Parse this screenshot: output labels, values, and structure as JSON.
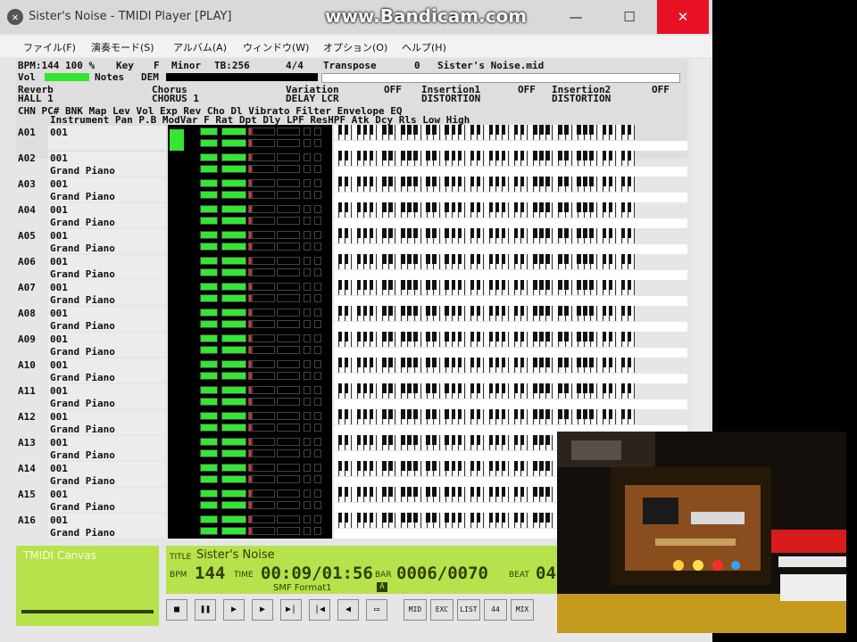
{
  "window": {
    "title": "Sister's Noise - TMIDI Player [PLAY]",
    "app_icon": "tmidi-logo-icon",
    "minimize_icon": "—",
    "maximize_icon": "☐",
    "close_icon": "✕"
  },
  "watermark": "www.Bandicam.com",
  "menu": [
    {
      "label": "ファイル(F)"
    },
    {
      "label": "演奏モード(S)"
    },
    {
      "label": "アルバム(A)"
    },
    {
      "label": "ウィンドウ(W)"
    },
    {
      "label": "オプション(O)"
    },
    {
      "label": "ヘルプ(H)"
    }
  ],
  "info": {
    "tempo_line": "BPM:144 100 %",
    "key_label": "Key",
    "key_value": "F",
    "mode": "Minor",
    "tick": "TB:256",
    "time_sig": "4/4",
    "transpose_label": "Transpose",
    "transpose_value": "0",
    "filename": "Sister's Noise.mid",
    "vol_label": "Vol",
    "notes_label": "Notes",
    "notes_value": "DEM",
    "reverb_label": "Reverb",
    "reverb_value": "HALL 1",
    "chorus_label": "Chorus",
    "chorus_value": "CHORUS 1",
    "variation_label": "Variation",
    "variation_state": "OFF",
    "variation_value": "DELAY LCR",
    "insertion1_label": "Insertion1",
    "insertion1_state": "OFF",
    "insertion1_value": "DISTORTION",
    "insertion2_label": "Insertion2",
    "insertion2_state": "OFF",
    "insertion2_value": "DISTORTION",
    "header1": "CHN PC# BNK Map   Lev Vol Exp Rev Cho Dl   Vibrato      Filter   Envelope EQ",
    "header2": "Instrument         Pan P.B ModVar F   Rat Dpt Dly LPF ResHPF Atk Dcy Rls Low  High"
  },
  "channels": [
    {
      "id": "A01",
      "program": "001",
      "instrument": "",
      "vol": 0.9,
      "keys": 0.35
    },
    {
      "id": "A02",
      "program": "001",
      "instrument": "Grand Piano",
      "vol": 0.0,
      "keys": 0
    },
    {
      "id": "A03",
      "program": "001",
      "instrument": "Grand Piano",
      "vol": 0.0,
      "keys": 0
    },
    {
      "id": "A04",
      "program": "001",
      "instrument": "Grand Piano",
      "vol": 0.0,
      "keys": 0
    },
    {
      "id": "A05",
      "program": "001",
      "instrument": "Grand Piano",
      "vol": 0.0,
      "keys": 0
    },
    {
      "id": "A06",
      "program": "001",
      "instrument": "Grand Piano",
      "vol": 0.0,
      "keys": 0
    },
    {
      "id": "A07",
      "program": "001",
      "instrument": "Grand Piano",
      "vol": 0.0,
      "keys": 0
    },
    {
      "id": "A08",
      "program": "001",
      "instrument": "Grand Piano",
      "vol": 0.0,
      "keys": 0
    },
    {
      "id": "A09",
      "program": "001",
      "instrument": "Grand Piano",
      "vol": 0.0,
      "keys": 0
    },
    {
      "id": "A10",
      "program": "001",
      "instrument": "Grand Piano",
      "vol": 0.0,
      "keys": 0
    },
    {
      "id": "A11",
      "program": "001",
      "instrument": "Grand Piano",
      "vol": 0.0,
      "keys": 0
    },
    {
      "id": "A12",
      "program": "001",
      "instrument": "Grand Piano",
      "vol": 0.0,
      "keys": 0
    },
    {
      "id": "A13",
      "program": "001",
      "instrument": "Grand Piano",
      "vol": 0.0,
      "keys": 0
    },
    {
      "id": "A14",
      "program": "001",
      "instrument": "Grand Piano",
      "vol": 0.0,
      "keys": 0
    },
    {
      "id": "A15",
      "program": "001",
      "instrument": "Grand Piano",
      "vol": 0.0,
      "keys": 0
    },
    {
      "id": "A16",
      "program": "001",
      "instrument": "Grand Piano",
      "vol": 0.0,
      "keys": 0
    }
  ],
  "canvas_panel": {
    "title": "TMIDI Canvas"
  },
  "lcd": {
    "title_label": "TITLE",
    "title": "Sister's Noise",
    "bpm_label": "BPM",
    "bpm": "144",
    "time_label": "TIME",
    "time": "00:09/01:56",
    "bar_label": "BAR",
    "bar": "0006/0070",
    "beat_label": "BEAT",
    "beat": "04",
    "format": "SMF Format1",
    "format_badge": "A"
  },
  "transport": [
    {
      "name": "stop-icon",
      "label": "■"
    },
    {
      "name": "pause-icon",
      "label": "❚❚"
    },
    {
      "name": "play-icon",
      "label": "▶"
    },
    {
      "name": "next-icon",
      "label": "▶"
    },
    {
      "name": "skip-forward-icon",
      "label": "▶|"
    },
    {
      "name": "skip-back-icon",
      "label": "|◀"
    },
    {
      "name": "rewind-icon",
      "label": "◀"
    },
    {
      "name": "window-icon",
      "label": "▭"
    },
    {
      "name": "mode-1-button",
      "label": "MID"
    },
    {
      "name": "mode-2-button",
      "label": "EXC"
    },
    {
      "name": "mode-3-button",
      "label": "LIST"
    },
    {
      "name": "mode-4-button",
      "label": "44"
    },
    {
      "name": "mode-5-button",
      "label": "MIX"
    }
  ],
  "colors": {
    "lcd": "#b6e24b",
    "meter": "#32e632",
    "close": "#e81123"
  }
}
